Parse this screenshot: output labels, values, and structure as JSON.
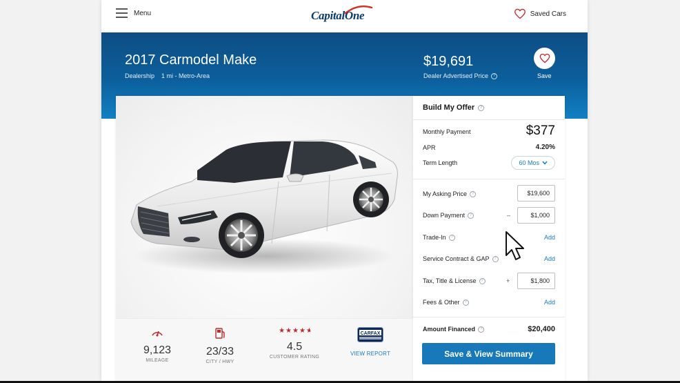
{
  "nav": {
    "menu_label": "Menu",
    "logo_text": "CapitalOne",
    "saved_cars_label": "Saved Cars"
  },
  "hero": {
    "title": "2017 Carmodel Make",
    "subtitle": "Dealership    1 mi - Metro-Area",
    "price": "$19,691",
    "price_caption": "Dealer Advertised Price",
    "save_label": "Save"
  },
  "stats": [
    {
      "icon": "gauge-icon",
      "value": "9,123",
      "label": "MILEAGE"
    },
    {
      "icon": "fuel-pump-icon",
      "value": "23/33",
      "label": "CITY / HWY"
    },
    {
      "icon": "star-rating-icon",
      "value": "4.5",
      "label": "CUSTOMER RATING",
      "rating": 4.5
    },
    {
      "icon": "carfax-icon",
      "label": "VIEW REPORT",
      "badge_text": "CARFAX"
    }
  ],
  "offer": {
    "title": "Build My Offer",
    "monthly_label": "Monthly Payment",
    "monthly_value": "$377",
    "apr_label": "APR",
    "apr_value": "4.20%",
    "term_label": "Term Length",
    "term_value": "60 Mos",
    "asking_label": "My Asking Price",
    "asking_value": "$19,600",
    "down_label": "Down Payment",
    "down_sign": "–",
    "down_value": "$1,000",
    "tradein_label": "Trade-In",
    "tradein_action": "Add",
    "service_label": "Service Contract & GAP",
    "service_action": "Add",
    "tax_label": "Tax, Title & License",
    "tax_sign": "+",
    "tax_value": "$1,800",
    "fees_label": "Fees & Other",
    "fees_action": "Add",
    "financed_label": "Amount Financed",
    "financed_value": "$20,400",
    "button_label": "Save & View Summary"
  },
  "colors": {
    "brand_blue": "#0b3a6b",
    "hero_blue": "#0c5f9c",
    "link_blue": "#1a7bc0",
    "button_blue": "#1779ba",
    "star_red": "#c0282e",
    "logo_swoosh": "#d22e1e"
  }
}
